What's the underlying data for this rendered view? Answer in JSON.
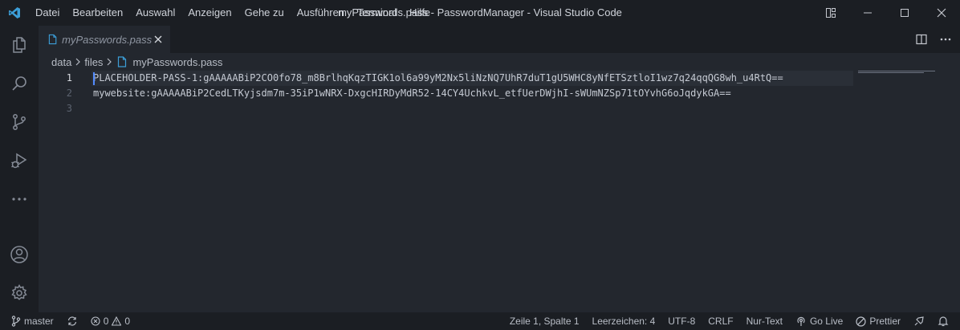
{
  "window": {
    "title": "myPasswords.pass - PasswordManager - Visual Studio Code",
    "menu": [
      "Datei",
      "Bearbeiten",
      "Auswahl",
      "Anzeigen",
      "Gehe zu",
      "Ausführen",
      "Terminal",
      "Hilfe"
    ]
  },
  "tab": {
    "label": "myPasswords.pass"
  },
  "breadcrumb": {
    "folder1": "data",
    "folder2": "files",
    "file": "myPasswords.pass"
  },
  "editor": {
    "lines": [
      {
        "number": "1",
        "text": "PLACEHOLDER-PASS-1:gAAAAABiP2CO0fo78_m8BrlhqKqzTIGK1ol6a99yM2Nx5liNzNQ7UhR7duT1gU5WHC8yNfETSztloI1wz7q24qqQG8wh_u4RtQ=="
      },
      {
        "number": "2",
        "text": "mywebsite:gAAAAABiP2CedLTKyjsdm7m-35iP1wNRX-DxgcHIRDyMdR52-14CY4UchkvL_etfUerDWjhI-sWUmNZSp71tOYvhG6oJqdykGA=="
      },
      {
        "number": "3",
        "text": ""
      }
    ]
  },
  "status": {
    "branch": "master",
    "errors": "0",
    "warnings": "0",
    "cursor_position": "Zeile 1, Spalte 1",
    "indentation": "Leerzeichen: 4",
    "encoding": "UTF-8",
    "line_endings": "CRLF",
    "language": "Nur-Text",
    "go_live": "Go Live",
    "prettier": "Prettier"
  },
  "colors": {
    "background": "#23272e",
    "chrome": "#1b1e23",
    "accent": "#3c9ed8",
    "cursor": "#528bff"
  },
  "icons": [
    "vscode-logo-icon",
    "layout-icon",
    "minimize-icon",
    "maximize-icon",
    "close-window-icon",
    "explorer-icon",
    "search-icon",
    "source-control-icon",
    "run-debug-icon",
    "more-icon",
    "account-icon",
    "settings-gear-icon",
    "file-icon",
    "close-icon",
    "split-editor-icon",
    "ellipsis-icon",
    "chevron-right-icon",
    "branch-icon",
    "sync-icon",
    "error-icon",
    "warning-icon",
    "broadcast-icon",
    "prettier-icon",
    "feedback-icon",
    "bell-icon"
  ]
}
